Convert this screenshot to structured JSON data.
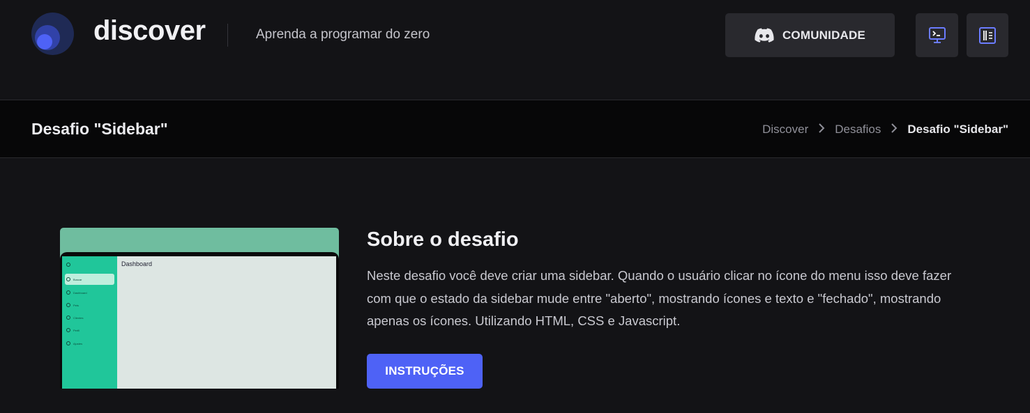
{
  "header": {
    "brand": "discover",
    "tagline": "Aprenda a programar do zero",
    "community_label": "COMUNIDADE",
    "icons": [
      "logo-icon",
      "discord-icon",
      "terminal-monitor-icon",
      "catalog-book-icon"
    ]
  },
  "titlebar": {
    "title": "Desafio \"Sidebar\"",
    "breadcrumb": [
      "Discover",
      "Desafios",
      "Desafio \"Sidebar\""
    ]
  },
  "preview": {
    "dashboard_label": "Dashboard",
    "sidebar_items": [
      "Buscar",
      "Dashboard",
      "Pets",
      "Clientes",
      "Perfil",
      "Ajustes"
    ]
  },
  "about": {
    "title": "Sobre o desafio",
    "text": "Neste desafio você deve criar uma sidebar. Quando o usuário clicar no ícone do menu isso deve fazer com que o estado da sidebar mude entre \"aberto\", mostrando ícones e texto e \"fechado\", mostrando apenas os ícones. Utilizando HTML, CSS e Javascript.",
    "button_label": "INSTRUÇÕES"
  },
  "colors": {
    "background": "#131316",
    "titlebar_bg": "#070708",
    "button_bg": "#29292e",
    "accent": "#4e62f6",
    "preview_green": "#20c69a"
  }
}
